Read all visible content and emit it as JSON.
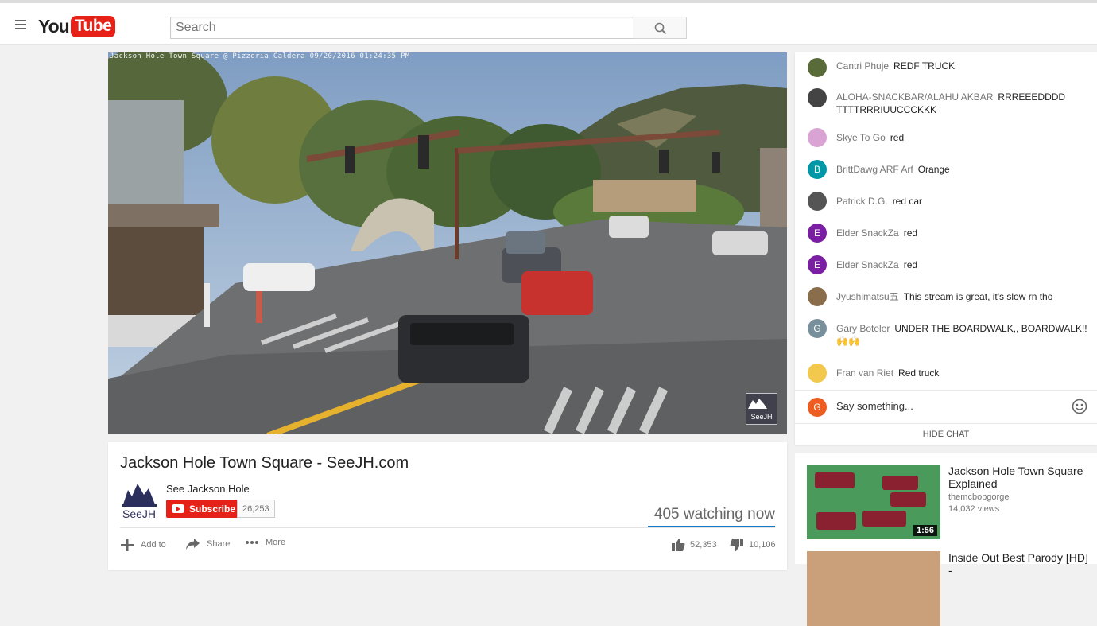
{
  "header": {
    "logo_you": "You",
    "logo_tube": "Tube",
    "search_placeholder": "Search"
  },
  "player": {
    "overlay_caption": "Jackson Hole Town Square @ Pizzeria Caldera 09/20/2016 01:24:35 PM",
    "watermark": "SeeJH"
  },
  "video_info": {
    "title": "Jackson Hole Town Square - SeeJH.com",
    "channel": "See Jackson Hole",
    "avatar_text": "SeeJH",
    "subscribe_label": "Subscribe",
    "subscriber_count": "26,253",
    "watching": "405 watching now",
    "actions": {
      "add_to": "Add to",
      "share": "Share",
      "more": "More"
    },
    "likes": "52,353",
    "dislikes": "10,106"
  },
  "chat": {
    "messages": [
      {
        "author": "Cantri Phuje",
        "text": "REDF TRUCK",
        "avatar": "",
        "color": "#5a6b3a"
      },
      {
        "author": "ALOHA-SNACKBAR/ALAHU AKBAR",
        "text": "RRREEEDDDD TTTTRRRIUUCCCKKK",
        "avatar": "",
        "color": "#444444"
      },
      {
        "author": "Skye To Go",
        "text": "red",
        "avatar": "",
        "color": "#d9a3d3"
      },
      {
        "author": "BrittDawg ARF Arf",
        "text": "Orange",
        "avatar": "B",
        "color": "#0097a7"
      },
      {
        "author": "Patrick D.G.",
        "text": "red car",
        "avatar": "",
        "color": "#555555"
      },
      {
        "author": "Elder SnackZa",
        "text": "red",
        "avatar": "E",
        "color": "#7b1fa2"
      },
      {
        "author": "Elder SnackZa",
        "text": "red",
        "avatar": "E",
        "color": "#7b1fa2"
      },
      {
        "author": "Jyushimatsu五",
        "text": "This stream is great, it's slow rn tho",
        "avatar": "",
        "color": "#8a6d4b"
      },
      {
        "author": "Gary Boteler",
        "text": "UNDER THE BOARDWALK,, BOARDWALK!! 🙌🙌",
        "avatar": "G",
        "color": "#78909c"
      },
      {
        "author": "Fran van Riet",
        "text": "Red truck",
        "avatar": "",
        "color": "#f2c94c"
      }
    ],
    "input_avatar": "G",
    "input_placeholder": "Say something...",
    "hide_label": "HIDE CHAT"
  },
  "related": [
    {
      "title": "Jackson Hole Town Square Explained",
      "channel": "themcbobgorge",
      "views": "14,032 views",
      "duration": "1:56"
    },
    {
      "title": "Inside Out Best Parody [HD] -",
      "channel": "",
      "views": "",
      "duration": ""
    }
  ]
}
